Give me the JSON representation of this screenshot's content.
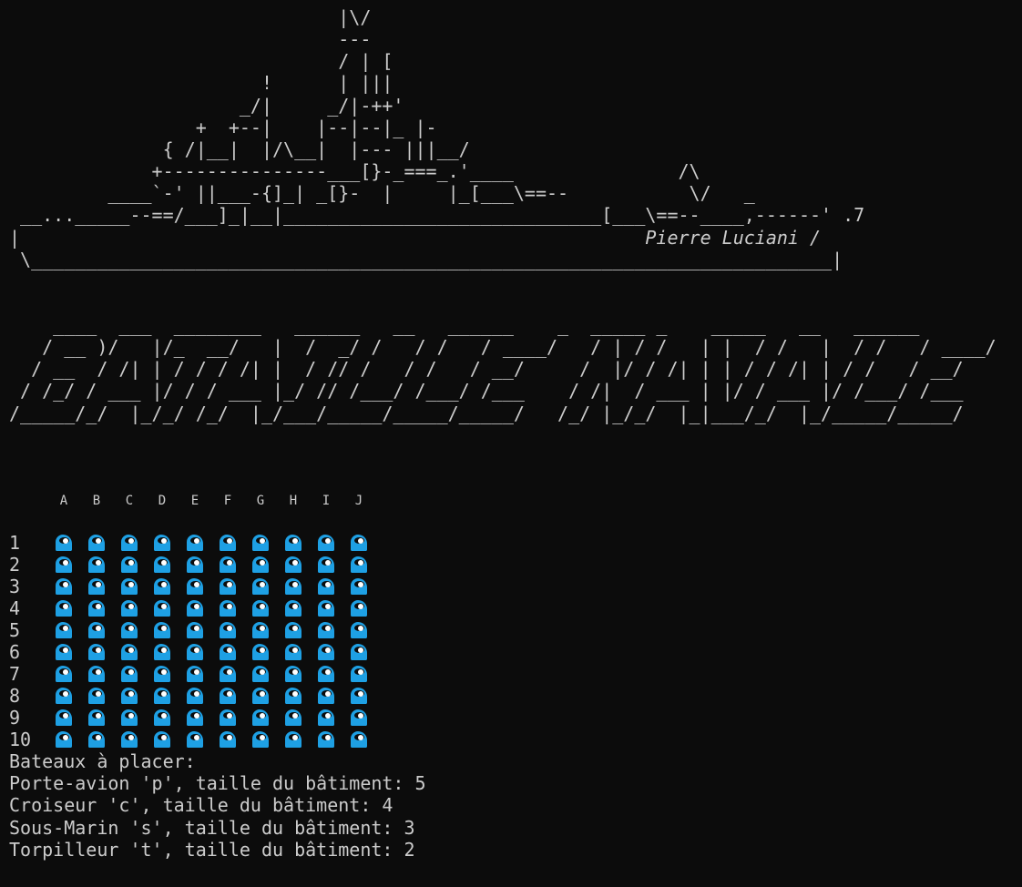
{
  "ship_art": {
    "lines": [
      "                              |\\/",
      "                              ---",
      "                              / | [",
      "                       !      | |||",
      "                     _/|     _/|-++'",
      "                 +  +--|    |--|--|_ |-",
      "              { /|__|  |/\\__|  |--- |||__/",
      "             +---------------___[}-_===_.'____               /\\",
      "         ____`-' ||___-{]_| _[}-  |     |_[___\\==--           \\/   _",
      " __..._____--==/___]_|__|_____________________________[___\\==--____,------' .7",
      "|                                                         "
    ],
    "credit": "Pierre Luciani /",
    "bottom": " \\_________________________________________________________________________|"
  },
  "title_art": {
    "lines": [
      "    ____  ___  ________   ______   __   ______    _  _____ _    _____   __   ______",
      "   / __ )/   |/_  __/   |  /  _/ /   / /   / ____/   / | / /   | |  / /   |  / /   / ____/",
      "  / __  / /| | / / / /| |  / // /   / /   / __/     /  |/ / /| | | / / /| | / /   / __/",
      " / /_/ / ___ |/ / / ___ |_/ // /___/ /___/ /___    / /|  / ___ | |/ / ___ |/ /___/ /___",
      "/_____/_/  |_/_/ /_/  |_/___/_____/_____/_____/   /_/ |_/_/  |_|___/_/  |_/_____/_____/"
    ]
  },
  "board": {
    "columns": [
      "A",
      "B",
      "C",
      "D",
      "E",
      "F",
      "G",
      "H",
      "I",
      "J"
    ],
    "rows": [
      "1",
      "2",
      "3",
      "4",
      "5",
      "6",
      "7",
      "8",
      "9",
      "10"
    ],
    "cell_icon": "water-wave-icon",
    "cell_color": "#1ea0e4"
  },
  "instructions": {
    "heading": "Bateaux à placer:",
    "ships": [
      "Porte-avion 'p', taille du bâtiment: 5",
      "Croiseur 'c', taille du bâtiment: 4",
      "Sous-Marin 's', taille du bâtiment: 3",
      "Torpilleur 't', taille du bâtiment: 2"
    ]
  }
}
